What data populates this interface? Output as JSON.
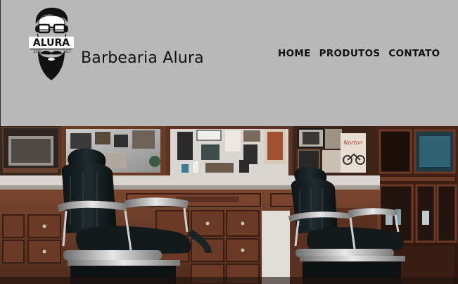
{
  "brand": {
    "logo_icon": "bearded-man-logo-icon",
    "logo_text": "ALURA",
    "logo_est_left": "ESTD",
    "logo_est_right": "2017",
    "name": "Barbearia Alura"
  },
  "nav": {
    "items": [
      {
        "label": "HOME"
      },
      {
        "label": "PRODUTOS"
      },
      {
        "label": "CONTATO"
      }
    ]
  },
  "hero": {
    "image_icon": "barbershop-interior-photo",
    "poster_text": "Norton"
  },
  "colors": {
    "header_bg": "#b8b8b8",
    "text": "#111111"
  }
}
